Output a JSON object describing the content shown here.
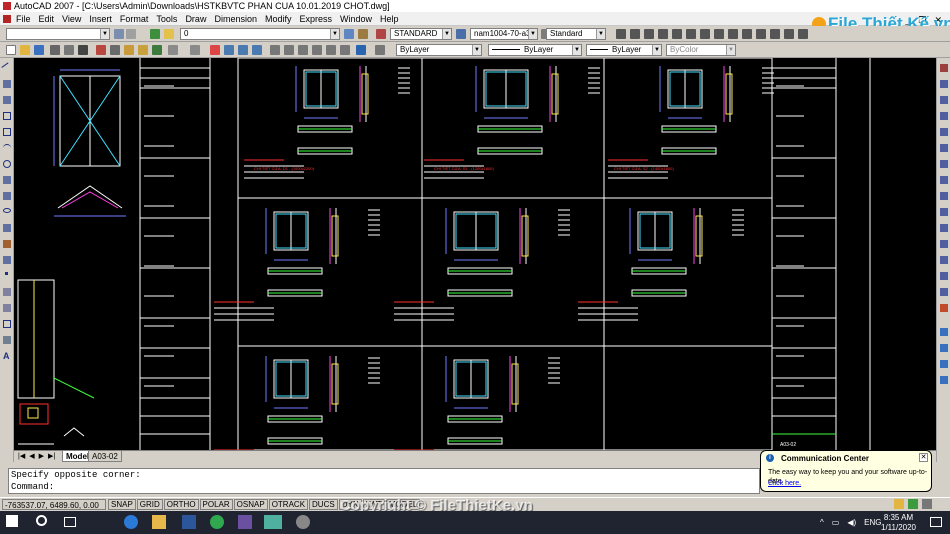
{
  "window": {
    "title": "AutoCAD 2007 - [C:\\Users\\Admin\\Downloads\\HSTKBVTC PHAN CUA 10.01.2019 CHOT.dwg]",
    "controls": [
      "_",
      "❐",
      "✕"
    ]
  },
  "menu": [
    "File",
    "Edit",
    "View",
    "Insert",
    "Format",
    "Tools",
    "Draw",
    "Dimension",
    "Modify",
    "Express",
    "Window",
    "Help"
  ],
  "toolbar1": {
    "layer_value": "0",
    "text_style": "STANDARD",
    "dim_style": "nam1004-70-a3",
    "table_style": "Standard"
  },
  "toolbar2": {
    "color": "ByLayer",
    "linetype": "ByLayer",
    "lineweight": "ByLayer",
    "plotstyle": "ByColor"
  },
  "drawing": {
    "red_labels": [
      "CHI TIẾT CỬA: D1 - (1000x2200)",
      "CHI TIẾT CỬA: S1 - (1200x1800)",
      "CHI TIẾT CỬA: S2 - (1400x1800)"
    ],
    "sheet_title": "A03-02"
  },
  "layout_tabs": {
    "model": "Model",
    "layout": "A03-02"
  },
  "command": {
    "line1": "Specify opposite corner:",
    "line2": "Command:"
  },
  "status": {
    "coords": "-763537.07, 6489.60, 0.00",
    "toggles": [
      "SNAP",
      "GRID",
      "ORTHO",
      "POLAR",
      "OSNAP",
      "OTRACK",
      "DUCS",
      "DYN",
      "LWT",
      "MODEL"
    ]
  },
  "balloon": {
    "title": "Communication Center",
    "message": "The easy way to keep you and your software up-to-date.",
    "link": "Click here."
  },
  "branding": {
    "logo_text": "File Thiết Kế.vn",
    "watermark": "Copyright © FileThietKe.vn"
  },
  "taskbar": {
    "time": "8:35 AM",
    "date": "1/11/2020",
    "lang": "ENG"
  },
  "colors": {
    "canvas": "#000000",
    "cad_white": "#ffffff",
    "cad_blue": "#6f7cff",
    "cad_magenta": "#ff3fe6",
    "cad_cyan": "#40e0ff",
    "cad_green": "#3cff3c",
    "cad_yellow": "#ffe84a",
    "cad_red": "#ff3030"
  }
}
